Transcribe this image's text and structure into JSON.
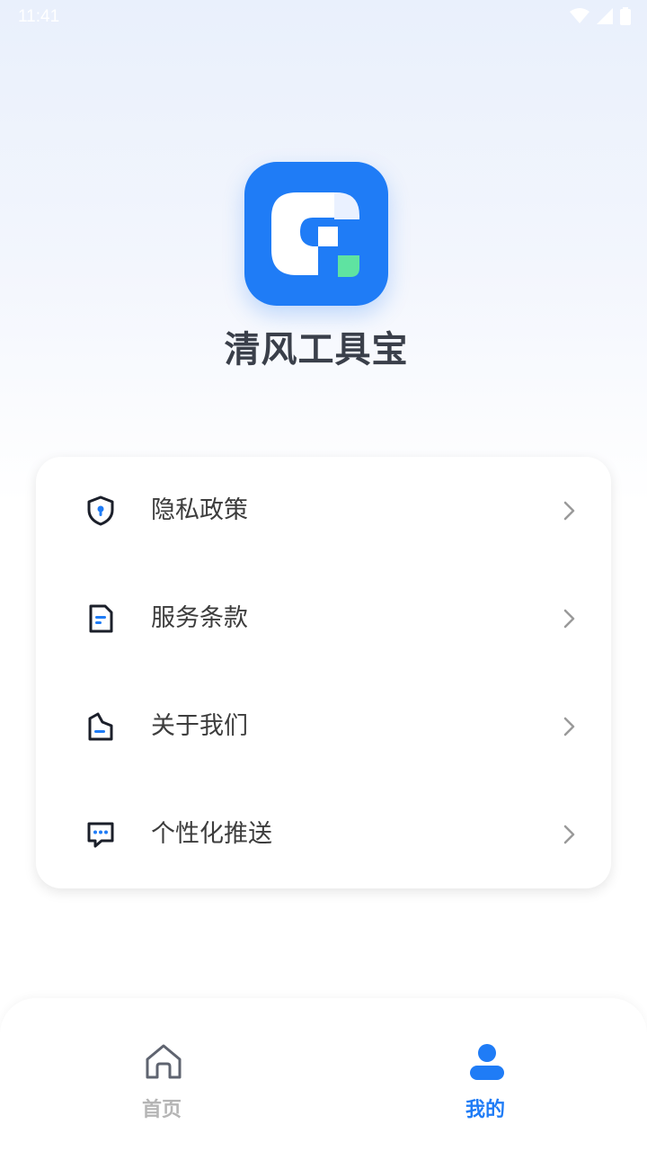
{
  "status_bar": {
    "time": "11:41"
  },
  "app": {
    "name": "清风工具宝"
  },
  "menu": {
    "items": [
      {
        "label": "隐私政策",
        "icon": "shield-lock-icon"
      },
      {
        "label": "服务条款",
        "icon": "document-icon"
      },
      {
        "label": "关于我们",
        "icon": "building-icon"
      },
      {
        "label": "个性化推送",
        "icon": "chat-bubble-icon"
      }
    ]
  },
  "tab_bar": {
    "tabs": [
      {
        "label": "首页",
        "icon": "home-icon",
        "active": false
      },
      {
        "label": "我的",
        "icon": "user-icon",
        "active": true
      }
    ]
  },
  "colors": {
    "accent": "#1f7cf6",
    "tab_inactive": "#b5b5b5",
    "icon_dark": "#1b1f2a",
    "leaf_green": "#5fe3a1"
  }
}
